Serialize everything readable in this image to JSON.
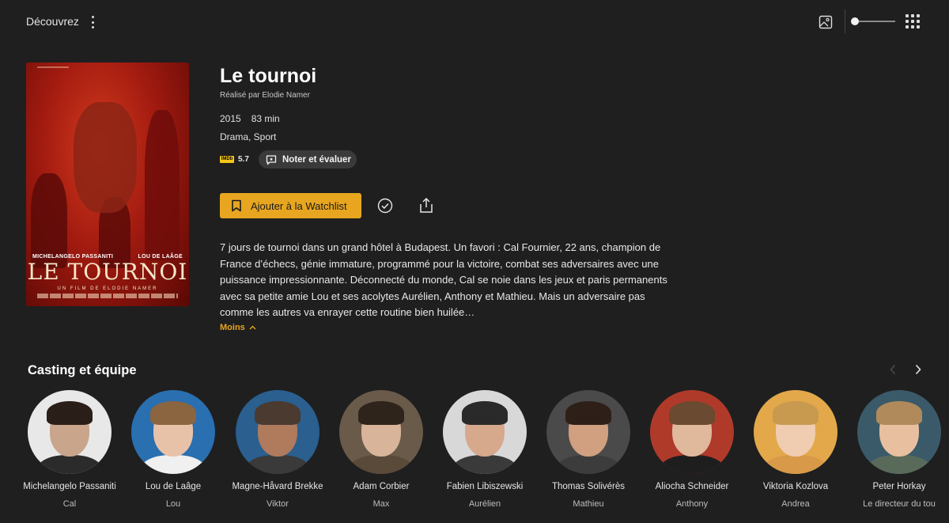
{
  "nav": {
    "label": "Découvrez"
  },
  "movie": {
    "title": "Le tournoi",
    "director": "Réalisé par Elodie Namer",
    "year": "2015",
    "duration": "83 min",
    "genres": "Drama, Sport",
    "imdb_logo": "IMDb",
    "imdb_score": "5.7",
    "synopsis": "7 jours de tournoi dans un grand hôtel à Budapest. Un favori : Cal Fournier, 22 ans, champion de France d’échecs, génie immature, programmé pour la victoire, combat ses adversaires avec une puissance impressionnante. Déconnecté du monde, Cal se noie dans les jeux et paris permanents avec sa petite amie Lou et ses acolytes Aurélien, Anthony et Mathieu. Mais un adversaire pas comme les autres va enrayer cette routine bien huilée…"
  },
  "poster": {
    "actor_left": "MICHELANGELO PASSANITI",
    "actor_right": "LOU DE LAÂGE",
    "title": "LE TOURNOI",
    "subtitle": "UN FILM DE ELODIE NAMER"
  },
  "actions": {
    "rate_label": "Noter et évaluer",
    "watchlist_label": "Ajouter à la Watchlist",
    "less_label": "Moins"
  },
  "cast_section": {
    "title": "Casting et équipe"
  },
  "cast": [
    {
      "name": "Michelangelo Passaniti",
      "role": "Cal"
    },
    {
      "name": "Lou de Laâge",
      "role": "Lou"
    },
    {
      "name": "Magne-Håvard Brekke",
      "role": "Viktor"
    },
    {
      "name": "Adam Corbier",
      "role": "Max"
    },
    {
      "name": "Fabien Libiszewski",
      "role": "Aurélien"
    },
    {
      "name": "Thomas Solivérès",
      "role": "Mathieu"
    },
    {
      "name": "Aliocha Schneider",
      "role": "Anthony"
    },
    {
      "name": "Viktoria Kozlova",
      "role": "Andrea"
    },
    {
      "name": "Peter Horkay",
      "role": "Le directeur du tou"
    }
  ],
  "colors": {
    "accent": "#e8a620",
    "background": "#1f1f1f",
    "imdb": "#f5c518"
  }
}
